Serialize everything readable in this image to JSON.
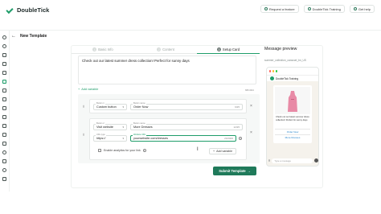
{
  "app": {
    "name": "DoubleTick"
  },
  "topbar": {
    "request_feature": "Request a feature",
    "training": "DoubleTick Training",
    "help": "Get help"
  },
  "page": {
    "back": "←",
    "title": "New Template"
  },
  "steps": [
    {
      "num": "1",
      "label": "Basic Info"
    },
    {
      "num": "2",
      "label": "Content"
    },
    {
      "num": "3",
      "label": "Setup Card"
    }
  ],
  "form": {
    "body_text": "Check out our latest summer dress collection! Perfect for sunny days",
    "add_variable": "Add variable",
    "body_counter": "68/1024"
  },
  "buttons": [
    {
      "type_label": "Button 1",
      "type_value": "Custom button",
      "text_label": "Button name",
      "text_value": "Order Now",
      "counter": "9/25"
    },
    {
      "type_label": "Button 2",
      "type_value": "Visit website",
      "text_label": "Button name",
      "text_value": "More Dresses",
      "text_counter": "12/25",
      "url_type_label": "URL type",
      "url_type_value": "https://",
      "url_label": "Website URL",
      "url_value": "yourwebsite.com/dresses",
      "url_counter": "23/2000",
      "analytics_label": "Enable analytics for your link",
      "add_variable": "Add variable"
    }
  ],
  "submit": {
    "label": "Submit Template",
    "arrow": "→"
  },
  "preview": {
    "title": "Message preview",
    "template_name": "summer_collection_carousel_bn_US",
    "business_name": "DoubleTick Training",
    "body": "Check out our latest summer dress collection! Perfect for sunny days",
    "button1": "Order Now",
    "button2": "More Dresses",
    "input_placeholder": "Type a message"
  },
  "colors": {
    "brand": "#1f9d6a",
    "submit": "#1f7a5a",
    "link": "#1a7ec9",
    "dress": "#e88aa6"
  }
}
